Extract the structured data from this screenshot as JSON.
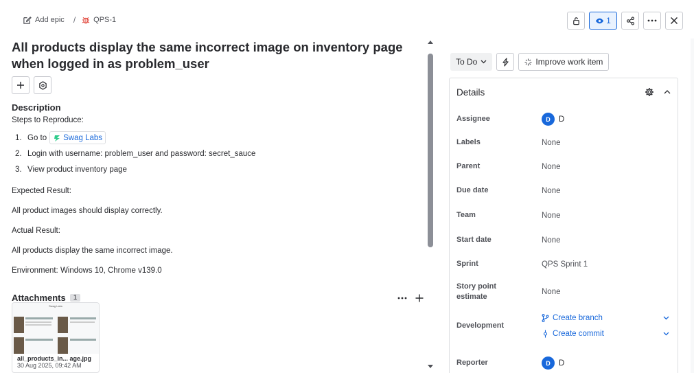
{
  "breadcrumb": {
    "epic_label": "Add epic",
    "separator": "/",
    "issue_key": "QPS-1"
  },
  "top_actions": {
    "watch_count": "1"
  },
  "issue": {
    "title": "All products display the same incorrect image on inventory page when logged in as problem_user",
    "description_heading": "Description",
    "steps_label": "Steps to Reproduce:",
    "steps": [
      {
        "num": "1.",
        "text": "Go to",
        "link": "Swag Labs"
      },
      {
        "num": "2.",
        "text": "Login with username: problem_user and password: secret_sauce"
      },
      {
        "num": "3.",
        "text": "View product inventory page"
      }
    ],
    "expected_label": "Expected Result:",
    "expected": "All product images should display correctly.",
    "actual_label": "Actual Result:",
    "actual": "All products display the same incorrect image.",
    "environment": "Environment: Windows 10, Chrome v139.0"
  },
  "attachments": {
    "heading": "Attachments",
    "count": "1",
    "file_name": "all_products_in... age.jpg",
    "file_date": "30 Aug 2025, 09:42 AM",
    "thumb_header": "Swag Labs"
  },
  "status": {
    "label": "To Do",
    "improve_label": "Improve work item"
  },
  "details": {
    "title": "Details",
    "fields": [
      {
        "label": "Assignee",
        "value": "D",
        "avatar": "D"
      },
      {
        "label": "Labels",
        "value": "None"
      },
      {
        "label": "Parent",
        "value": "None"
      },
      {
        "label": "Due date",
        "value": "None"
      },
      {
        "label": "Team",
        "value": "None"
      },
      {
        "label": "Start date",
        "value": "None"
      },
      {
        "label": "Sprint",
        "value": "QPS Sprint 1"
      },
      {
        "label": "Story point estimate",
        "value": "None"
      },
      {
        "label": "Development",
        "branch": "Create branch",
        "commit": "Create commit"
      },
      {
        "label": "Reporter",
        "value": "D",
        "avatar": "D"
      }
    ]
  },
  "colors": {
    "accent": "#1868db",
    "text": "#292a2e",
    "muted": "#505258",
    "bug_red": "#e2483d"
  }
}
